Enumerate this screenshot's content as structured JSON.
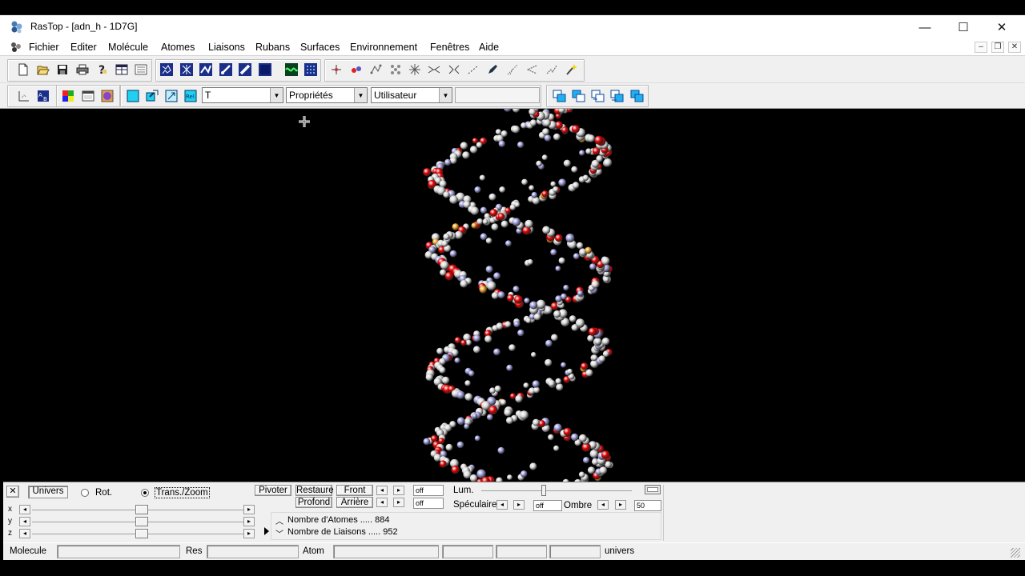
{
  "window": {
    "title": "RasTop - [adn_h - 1D7G]",
    "controls": {
      "minimize": "—",
      "maximize": "☐",
      "close": "✕"
    }
  },
  "menu": {
    "items": [
      "Fichier",
      "Editer",
      "Molécule",
      "Atomes",
      "Liaisons",
      "Rubans",
      "Surfaces",
      "Environnement",
      "Fenêtres",
      "Aide"
    ],
    "mdi": {
      "minimize": "–",
      "restore": "❐",
      "close": "✕"
    }
  },
  "toolbar2": {
    "dropdown1": "T",
    "dropdown2": "Propriétés",
    "dropdown3": "Utilisateur",
    "text_field": ""
  },
  "controls": {
    "close": "✕",
    "univers_button": "Univers",
    "rot_label": "Rot.",
    "trans_zoom_label": "Trans./Zoom",
    "mode_selected": "trans_zoom",
    "axes": [
      "x",
      "y",
      "z"
    ],
    "axis_positions": [
      0.52,
      0.52,
      0.52
    ],
    "pivoter_button": "Pivoter",
    "restaure_button": "Restaure",
    "profond_button": "Profond",
    "front_button": "Front",
    "arriere_button": "Arrière",
    "front_value": "off",
    "arriere_value": "off",
    "lum_label": "Lum.",
    "lum_position": 0.4,
    "speculaire_label": "Spéculaire",
    "speculaire_value": "off",
    "ombre_label": "Ombre",
    "ombre_value": "50",
    "info_atoms": "Nombre d'Atomes ..... 884",
    "info_bonds": "Nombre de Liaisons ..... 952"
  },
  "statusbar": {
    "molecule_label": "Molecule",
    "res_label": "Res",
    "atom_label": "Atom",
    "univers_label": "univers"
  },
  "colors": {
    "carbon": "#d8d8d8",
    "oxygen": "#e00000",
    "nitrogen": "#9a9ad8",
    "phosphorus": "#e8a020",
    "viewer_bg": "#000000"
  }
}
